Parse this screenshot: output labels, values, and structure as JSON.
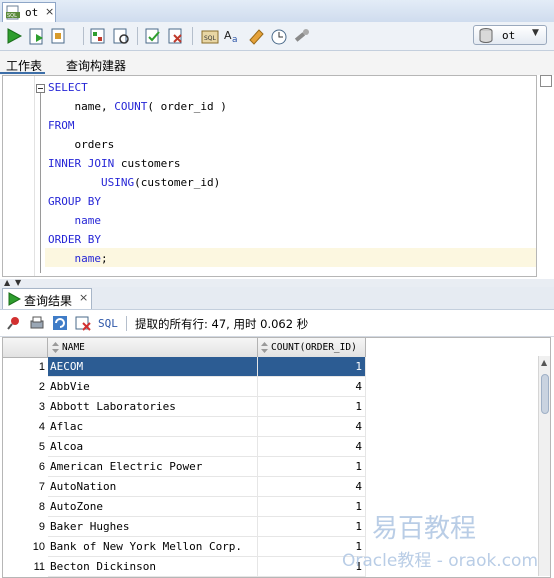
{
  "document_tab": {
    "label": "ot",
    "close": "×"
  },
  "toolbar": {
    "buttons": [
      "run-statement",
      "run-script",
      "autotrace",
      "explain-plan",
      "sql-tuning",
      "commit",
      "rollback",
      "sql-worksheet-history",
      "format",
      "clear",
      "history",
      "sql-tuning-advisor",
      "tools"
    ],
    "connection": "ot"
  },
  "editor_tabs": {
    "worksheet": "工作表",
    "query_builder": "查询构建器"
  },
  "editor": {
    "lines": [
      {
        "parts": [
          {
            "t": "SELECT",
            "kw": true
          }
        ]
      },
      {
        "parts": [
          {
            "t": "    name, "
          },
          {
            "t": "COUNT",
            "kw": true
          },
          {
            "t": "( order_id )"
          }
        ]
      },
      {
        "parts": [
          {
            "t": "FROM",
            "kw": true
          }
        ]
      },
      {
        "parts": [
          {
            "t": "    orders"
          }
        ]
      },
      {
        "parts": [
          {
            "t": "INNER JOIN",
            "kw": true
          },
          {
            "t": " customers"
          }
        ]
      },
      {
        "parts": [
          {
            "t": "        "
          },
          {
            "t": "USING",
            "kw": true
          },
          {
            "t": "(customer_id)"
          }
        ]
      },
      {
        "parts": [
          {
            "t": "GROUP BY",
            "kw": true
          }
        ]
      },
      {
        "parts": [
          {
            "t": "    "
          },
          {
            "t": "name",
            "kw": true
          }
        ]
      },
      {
        "parts": [
          {
            "t": "ORDER BY",
            "kw": true
          }
        ]
      },
      {
        "parts": [
          {
            "t": "    "
          },
          {
            "t": "name",
            "kw": true
          },
          {
            "t": ";"
          }
        ]
      }
    ]
  },
  "results": {
    "tab_label": "查询结果",
    "tab_close": "×",
    "sql_label": "SQL",
    "status": "提取的所有行: 47, 用时 0.062 秒",
    "columns": [
      "NAME",
      "COUNT(ORDER_ID)"
    ],
    "rows": [
      {
        "num": "1",
        "name": "AECOM",
        "count": "1"
      },
      {
        "num": "2",
        "name": "AbbVie",
        "count": "4"
      },
      {
        "num": "3",
        "name": "Abbott Laboratories",
        "count": "1"
      },
      {
        "num": "4",
        "name": "Aflac",
        "count": "4"
      },
      {
        "num": "5",
        "name": "Alcoa",
        "count": "4"
      },
      {
        "num": "6",
        "name": "American Electric Power",
        "count": "1"
      },
      {
        "num": "7",
        "name": "AutoNation",
        "count": "4"
      },
      {
        "num": "8",
        "name": "AutoZone",
        "count": "1"
      },
      {
        "num": "9",
        "name": "Baker Hughes",
        "count": "1"
      },
      {
        "num": "10",
        "name": "Bank of New York Mellon Corp.",
        "count": "1"
      },
      {
        "num": "11",
        "name": "Becton Dickinson",
        "count": "1"
      }
    ],
    "selected_row": 0
  },
  "watermark": {
    "line1": "易百教程",
    "line2": "Oracle教程 - oraok.com"
  },
  "colors": {
    "keyword": "#2626d6",
    "selection": "#2c5c93",
    "current_line": "#fcf7e0"
  }
}
